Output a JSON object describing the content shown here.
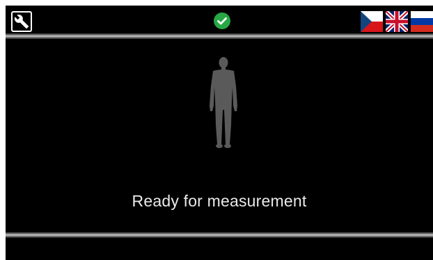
{
  "topbar": {
    "settings_icon": "wrench-icon",
    "status_icon": "check-circle-icon",
    "status_color": "#28a745",
    "languages": [
      {
        "code": "cs",
        "icon": "flag-czech-icon"
      },
      {
        "code": "en",
        "icon": "flag-uk-icon"
      },
      {
        "code": "ru",
        "icon": "flag-russia-icon"
      }
    ]
  },
  "main": {
    "figure_icon": "standing-person-icon",
    "status_message": "Ready for measurement"
  },
  "colors": {
    "background": "#000000",
    "text": "#eaeaea",
    "figure": "#5a5a5a"
  }
}
